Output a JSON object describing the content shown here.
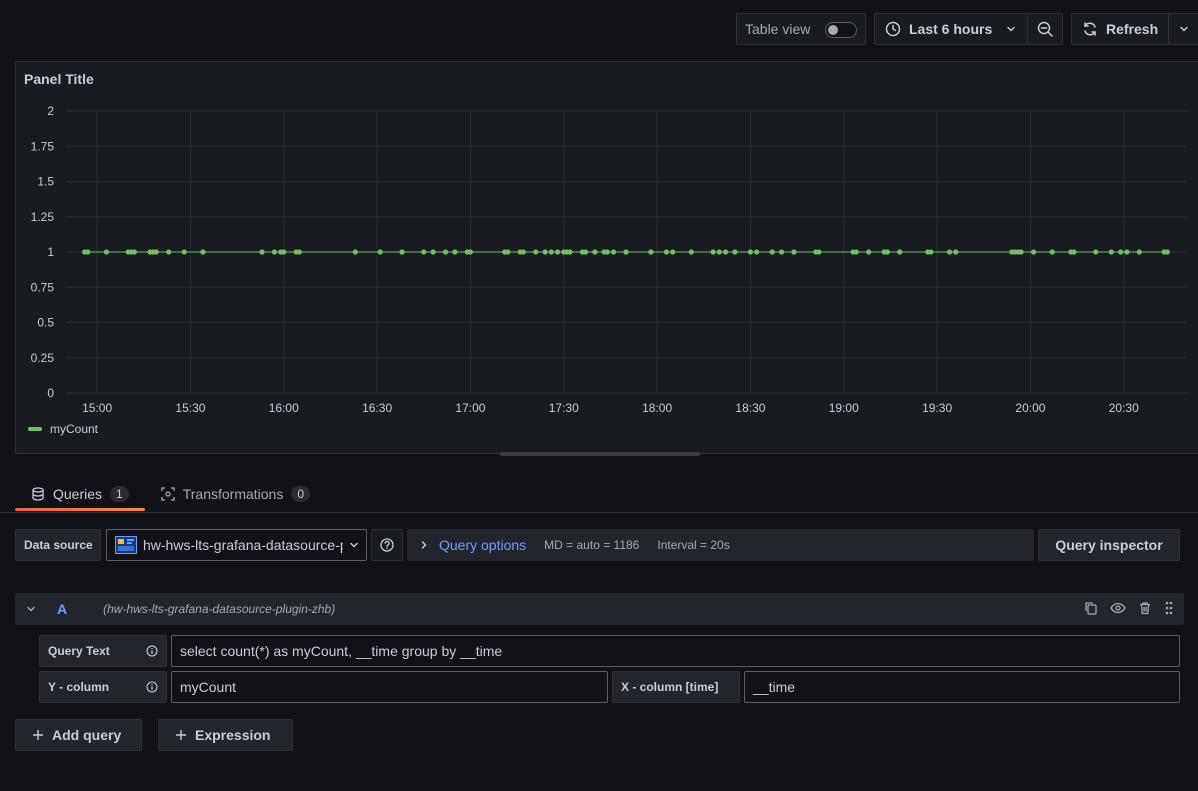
{
  "toolbar": {
    "table_view_label": "Table view",
    "table_view_enabled": false,
    "time_range_label": "Last 6 hours",
    "refresh_label": "Refresh"
  },
  "panel": {
    "title": "Panel Title"
  },
  "chart_data": {
    "type": "scatter",
    "title": "Panel Title",
    "xlabel": "",
    "ylabel": "",
    "ylim": [
      0,
      2
    ],
    "y_ticks": [
      "0",
      "0.25",
      "0.5",
      "0.75",
      "1",
      "1.25",
      "1.5",
      "1.75",
      "2"
    ],
    "x_ticks": [
      "15:00",
      "15:30",
      "16:00",
      "16:30",
      "17:00",
      "17:30",
      "18:00",
      "18:30",
      "19:00",
      "19:30",
      "20:00",
      "20:30"
    ],
    "grid": true,
    "legend": "bottom-left",
    "series": [
      {
        "name": "myCount",
        "color": "#73bf69",
        "x": [
          "14:56",
          "14:57",
          "15:03",
          "15:10",
          "15:11",
          "15:12",
          "15:17",
          "15:18",
          "15:19",
          "15:23",
          "15:28",
          "15:34",
          "15:53",
          "15:57",
          "15:59",
          "16:00",
          "16:04",
          "16:05",
          "16:23",
          "16:31",
          "16:38",
          "16:45",
          "16:48",
          "16:52",
          "16:55",
          "16:59",
          "17:00",
          "17:11",
          "17:12",
          "17:16",
          "17:17",
          "17:21",
          "17:24",
          "17:26",
          "17:28",
          "17:30",
          "17:31",
          "17:32",
          "17:36",
          "17:37",
          "17:40",
          "17:43",
          "17:44",
          "17:46",
          "17:50",
          "17:58",
          "18:03",
          "18:05",
          "18:11",
          "18:18",
          "18:20",
          "18:22",
          "18:25",
          "18:30",
          "18:32",
          "18:37",
          "18:40",
          "18:44",
          "18:51",
          "18:52",
          "19:03",
          "19:04",
          "19:08",
          "19:13",
          "19:14",
          "19:18",
          "19:27",
          "19:28",
          "19:34",
          "19:36",
          "19:54",
          "19:55",
          "19:56",
          "19:57",
          "20:01",
          "20:07",
          "20:13",
          "20:14",
          "20:21",
          "20:26",
          "20:29",
          "20:31",
          "20:35",
          "20:43",
          "20:44"
        ],
        "y": [
          1,
          1,
          1,
          1,
          1,
          1,
          1,
          1,
          1,
          1,
          1,
          1,
          1,
          1,
          1,
          1,
          1,
          1,
          1,
          1,
          1,
          1,
          1,
          1,
          1,
          1,
          1,
          1,
          1,
          1,
          1,
          1,
          1,
          1,
          1,
          1,
          1,
          1,
          1,
          1,
          1,
          1,
          1,
          1,
          1,
          1,
          1,
          1,
          1,
          1,
          1,
          1,
          1,
          1,
          1,
          1,
          1,
          1,
          1,
          1,
          1,
          1,
          1,
          1,
          1,
          1,
          1,
          1,
          1,
          1,
          1,
          1,
          1,
          1,
          1,
          1,
          1,
          1,
          1,
          1,
          1,
          1,
          1,
          1,
          1
        ]
      }
    ]
  },
  "tabs": [
    {
      "label": "Queries",
      "count": "1",
      "icon": "database-icon"
    },
    {
      "label": "Transformations",
      "count": "0",
      "icon": "transform-icon"
    }
  ],
  "datasource": {
    "label": "Data source",
    "selected": "hw-hws-lts-grafana-datasource-plugin-zhb"
  },
  "query_options": {
    "label": "Query options",
    "md": "MD = auto = 1186",
    "interval": "Interval = 20s"
  },
  "query_inspector_label": "Query inspector",
  "query": {
    "ref_id": "A",
    "datasource_name": "(hw-hws-lts-grafana-datasource-plugin-zhb)",
    "query_text_label": "Query Text",
    "query_text": "select count(*) as myCount, __time group by __time",
    "y_column_label": "Y - column",
    "y_column": "myCount",
    "x_column_label": "X - column [time]",
    "x_column": "__time"
  },
  "add_query_label": "Add query",
  "expression_label": "Expression"
}
